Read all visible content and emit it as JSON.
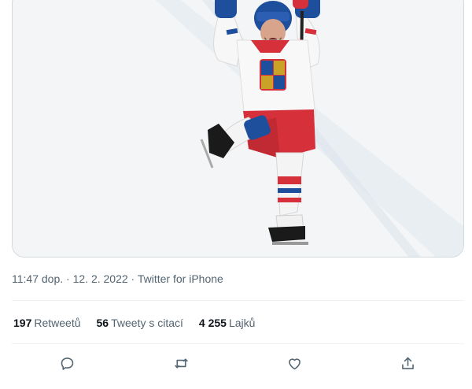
{
  "tweet": {
    "time": "11:47 dop.",
    "date": "12. 2. 2022",
    "source": "Twitter for iPhone",
    "separator": "·"
  },
  "stats": [
    {
      "count": "197",
      "label": "Retweetů"
    },
    {
      "count": "56",
      "label": "Tweety s citací"
    },
    {
      "count": "4 255",
      "label": "Lajků"
    }
  ],
  "actions": [
    {
      "icon": "reply-icon"
    },
    {
      "icon": "retweet-icon"
    },
    {
      "icon": "like-icon"
    },
    {
      "icon": "share-icon"
    }
  ],
  "colors": {
    "text_secondary": "#536471",
    "border": "#eff3f4",
    "jersey_red": "#d6303a",
    "jersey_blue": "#1d4f9c"
  }
}
